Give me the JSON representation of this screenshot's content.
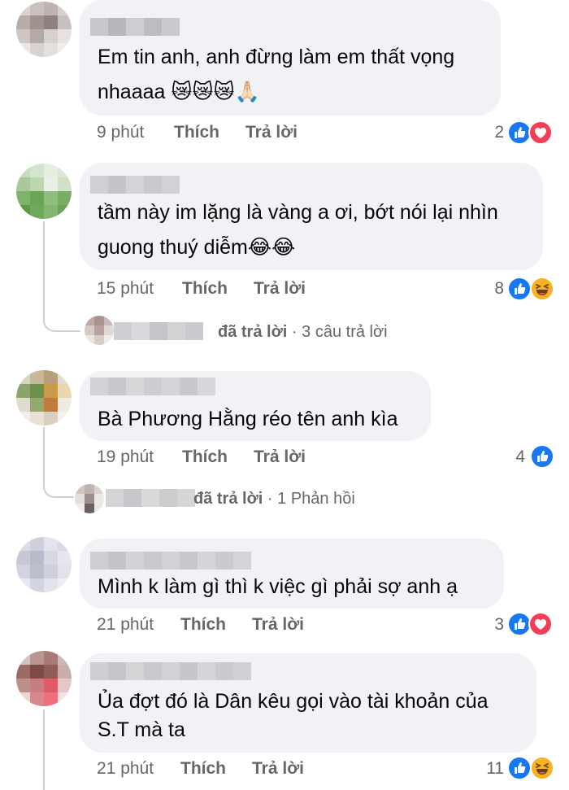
{
  "comments": [
    {
      "text_lines": [
        "Em tin anh, anh đừng làm em thất vọng",
        "nhaaaa 😿😿😿🙏🏻"
      ],
      "time": "9 phút",
      "like_label": "Thích",
      "reply_label": "Trả lời",
      "reaction_count": "2",
      "reactions": [
        "like-icon",
        "love-icon"
      ]
    },
    {
      "text_lines": [
        "tầm này im lặng là vàng a ơi, bớt nói lại nhìn",
        "guong thuý diễm😂😂"
      ],
      "time": "15 phút",
      "like_label": "Thích",
      "reply_label": "Trả lời",
      "reaction_count": "8",
      "reactions": [
        "like-icon",
        "haha-icon"
      ],
      "replies_summary": {
        "action": "đã trả lời",
        "separator": "·",
        "count_text": "3 câu trả lời"
      }
    },
    {
      "text_lines": [
        "Bà Phương Hằng réo tên anh kìa"
      ],
      "time": "19 phút",
      "like_label": "Thích",
      "reply_label": "Trả lời",
      "reaction_count": "4",
      "reactions": [
        "like-icon"
      ],
      "replies_summary": {
        "action": "đã trả lời",
        "separator": "·",
        "count_text": "1 Phản hồi"
      }
    },
    {
      "text_lines": [
        "Mình k làm gì thì k việc gì phải  sợ anh ạ"
      ],
      "time": "21 phút",
      "like_label": "Thích",
      "reply_label": "Trả lời",
      "reaction_count": "3",
      "reactions": [
        "like-icon",
        "love-icon"
      ]
    },
    {
      "text_lines": [
        "Ủa đợt đó là Dân kêu gọi vào tài khoản của",
        "S.T mà ta"
      ],
      "time": "21 phút",
      "like_label": "Thích",
      "reply_label": "Trả lời",
      "reaction_count": "11",
      "reactions": [
        "like-icon",
        "haha-icon"
      ]
    }
  ],
  "colors": {
    "bubble": "#f0f2f5",
    "meta_text": "#65676b",
    "like_blue": "#1877f2",
    "love_red": "#f33e58",
    "haha_yellow": "#f7b125"
  }
}
